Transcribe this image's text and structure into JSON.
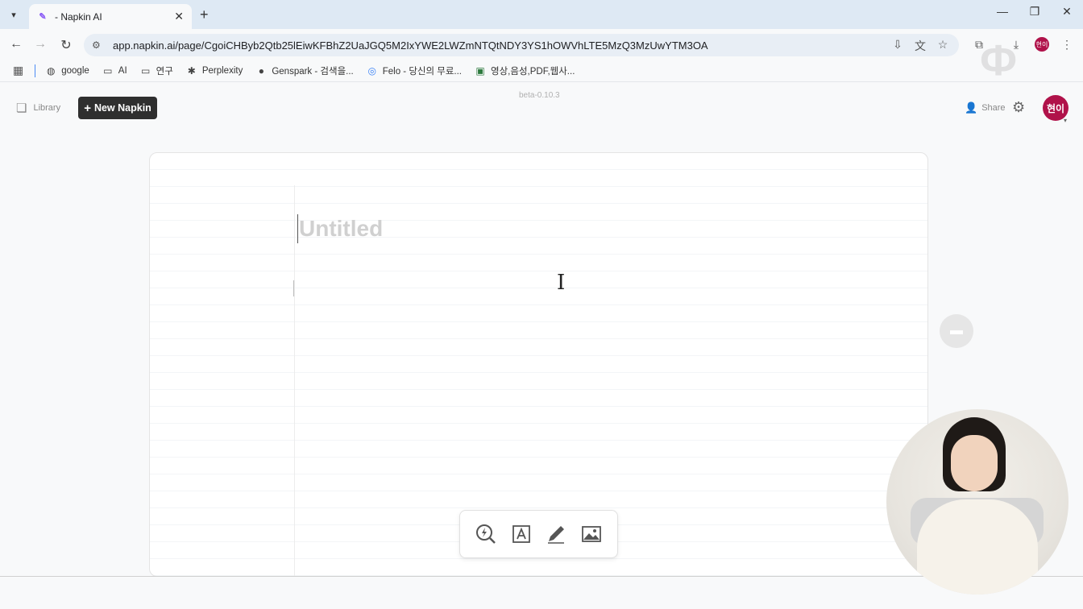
{
  "browser": {
    "tab_title": "- Napkin AI",
    "url": "app.napkin.ai/page/CgoiCHByb2Qtb25lEiwKFBhZ2UaJGQ5M2IxYWE2LWZmNTQtNDY3YS1hOWVhLTE5MzQ3MzUwYTM3OA",
    "profile_initials": "현이",
    "bookmarks": [
      {
        "label": "google",
        "icon": "globe-icon"
      },
      {
        "label": "AI",
        "icon": "folder-icon"
      },
      {
        "label": "연구",
        "icon": "folder-icon"
      },
      {
        "label": "Perplexity",
        "icon": "perplexity-icon"
      },
      {
        "label": "Genspark - 검색을...",
        "icon": "genspark-icon"
      },
      {
        "label": "Felo - 당신의 무료...",
        "icon": "felo-icon"
      },
      {
        "label": "영상,음성,PDF,웹사...",
        "icon": "image-icon"
      }
    ]
  },
  "app": {
    "library_label": "Library",
    "new_napkin_label": "New Napkin",
    "version": "beta-0.10.3",
    "share_label": "Share",
    "avatar_initials": "현이",
    "doc_title_placeholder": "Untitled"
  },
  "colors": {
    "accent_dark": "#2f2f2f",
    "avatar_bg": "#b0124a",
    "tab_strip": "#dee9f4"
  }
}
